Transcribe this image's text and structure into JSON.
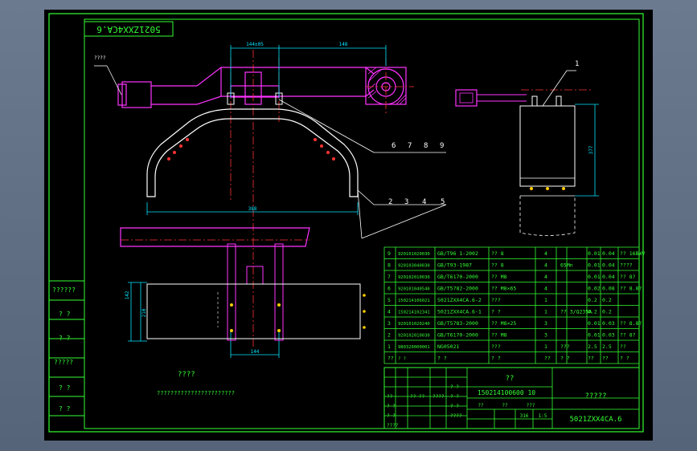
{
  "title_tag": "5021ZXX4CA.6",
  "left_label": "????",
  "dims": {
    "top1": "144±05",
    "top2": "148",
    "arch": "388",
    "right": "377",
    "side_outer": "142",
    "side_inner": "210",
    "bottom": "144"
  },
  "callouts": {
    "upper": [
      "6",
      "7",
      "8",
      "9"
    ],
    "lower": [
      "2",
      "3",
      "4",
      "5"
    ],
    "detail": "1"
  },
  "notes": {
    "heading": "????",
    "body": "???????????????????????"
  },
  "side_stamps": [
    "??????",
    "? ?",
    "? ?",
    "?????",
    "? ?",
    "? ?"
  ],
  "bom": [
    [
      "9",
      "920101020030",
      "GB/T96 1-2002",
      "?? 8",
      "4",
      "",
      "0.01",
      "0.04",
      "?? 16BWV"
    ],
    [
      "8",
      "920103040030",
      "GB/T93-1987",
      "?? 8",
      "4",
      "65Mn",
      "0.01",
      "0.04",
      "????"
    ],
    [
      "7",
      "920102010030",
      "GB/T6170-2000",
      "?? M8",
      "4",
      "",
      "0.01",
      "0.04",
      "?? 8?"
    ],
    [
      "6",
      "920101040540",
      "GB/T5782-2000",
      "?? M8×65",
      "4",
      "",
      "0.02",
      "0.08",
      "?? 8.8?"
    ],
    [
      "5",
      "150214106021",
      "5021ZXX4CA.6-2",
      "???",
      "1",
      "",
      "0.2",
      "0.2",
      ""
    ],
    [
      "4",
      "150214102341",
      "5021ZXX4CA.6-1",
      "? ?",
      "1",
      "?? 3/Q235A",
      "0.2",
      "0.2",
      ""
    ],
    [
      "3",
      "920101020240",
      "GB/T5783-2000",
      "?? M8×25",
      "3",
      "",
      "0.01",
      "0.03",
      "?? 8.8?"
    ],
    [
      "2",
      "920102010030",
      "GB/T6170-2000",
      "?? M8",
      "3",
      "",
      "0.01",
      "0.03",
      "?? 8?"
    ],
    [
      "1",
      "980320000001",
      "NG05021",
      "???",
      "1",
      "???",
      "2.5",
      "2.5",
      "??"
    ],
    [
      "??",
      "? ?",
      "? ?",
      "? ?",
      "??",
      "? ?",
      "??",
      "??",
      "? ?"
    ]
  ],
  "title_block": {
    "name_top": "??",
    "code": "150214100600 10",
    "company": "?????",
    "drawing_no": "5021ZXX4CA.6",
    "cell_1": "??",
    "cell_2": "?? ??",
    "cell_3": "????",
    "cell_4": "? ?",
    "cell_5": "? ?",
    "cell_6": "????",
    "weight": "316",
    "scale": "1:5",
    "rev_1": "??",
    "rev_2": "??",
    "rev_3": "???",
    "r1": "? ?",
    "r2": "? ?",
    "r3": "? ?",
    "r4": "????"
  }
}
